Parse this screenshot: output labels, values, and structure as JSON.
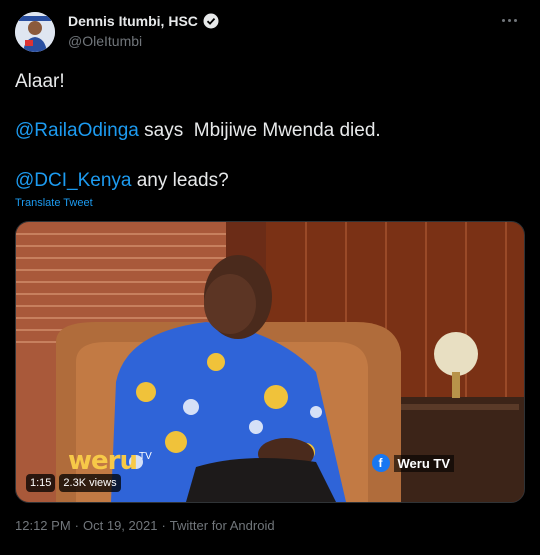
{
  "author": {
    "display_name": "Dennis Itumbi, HSC",
    "handle": "@OleItumbi"
  },
  "tweet": {
    "line1": "Alaar!",
    "line2_mention": "@RailaOdinga",
    "line2_rest": " says  Mbijiwe Mwenda died.",
    "line3_mention": "@DCI_Kenya",
    "line3_rest": " any leads?",
    "translate_label": "Translate Tweet"
  },
  "media": {
    "duration": "1:15",
    "views": "2.3K views",
    "logo_text": "weru",
    "logo_tv": "TV",
    "channel_label": "Weru TV"
  },
  "footer": {
    "time": "12:12 PM",
    "date": "Oct 19, 2021",
    "source": "Twitter for Android",
    "separator": "·"
  },
  "colors": {
    "background": "#000000",
    "text": "#e7e9ea",
    "secondary": "#71767b",
    "link": "#1d9bf0"
  }
}
